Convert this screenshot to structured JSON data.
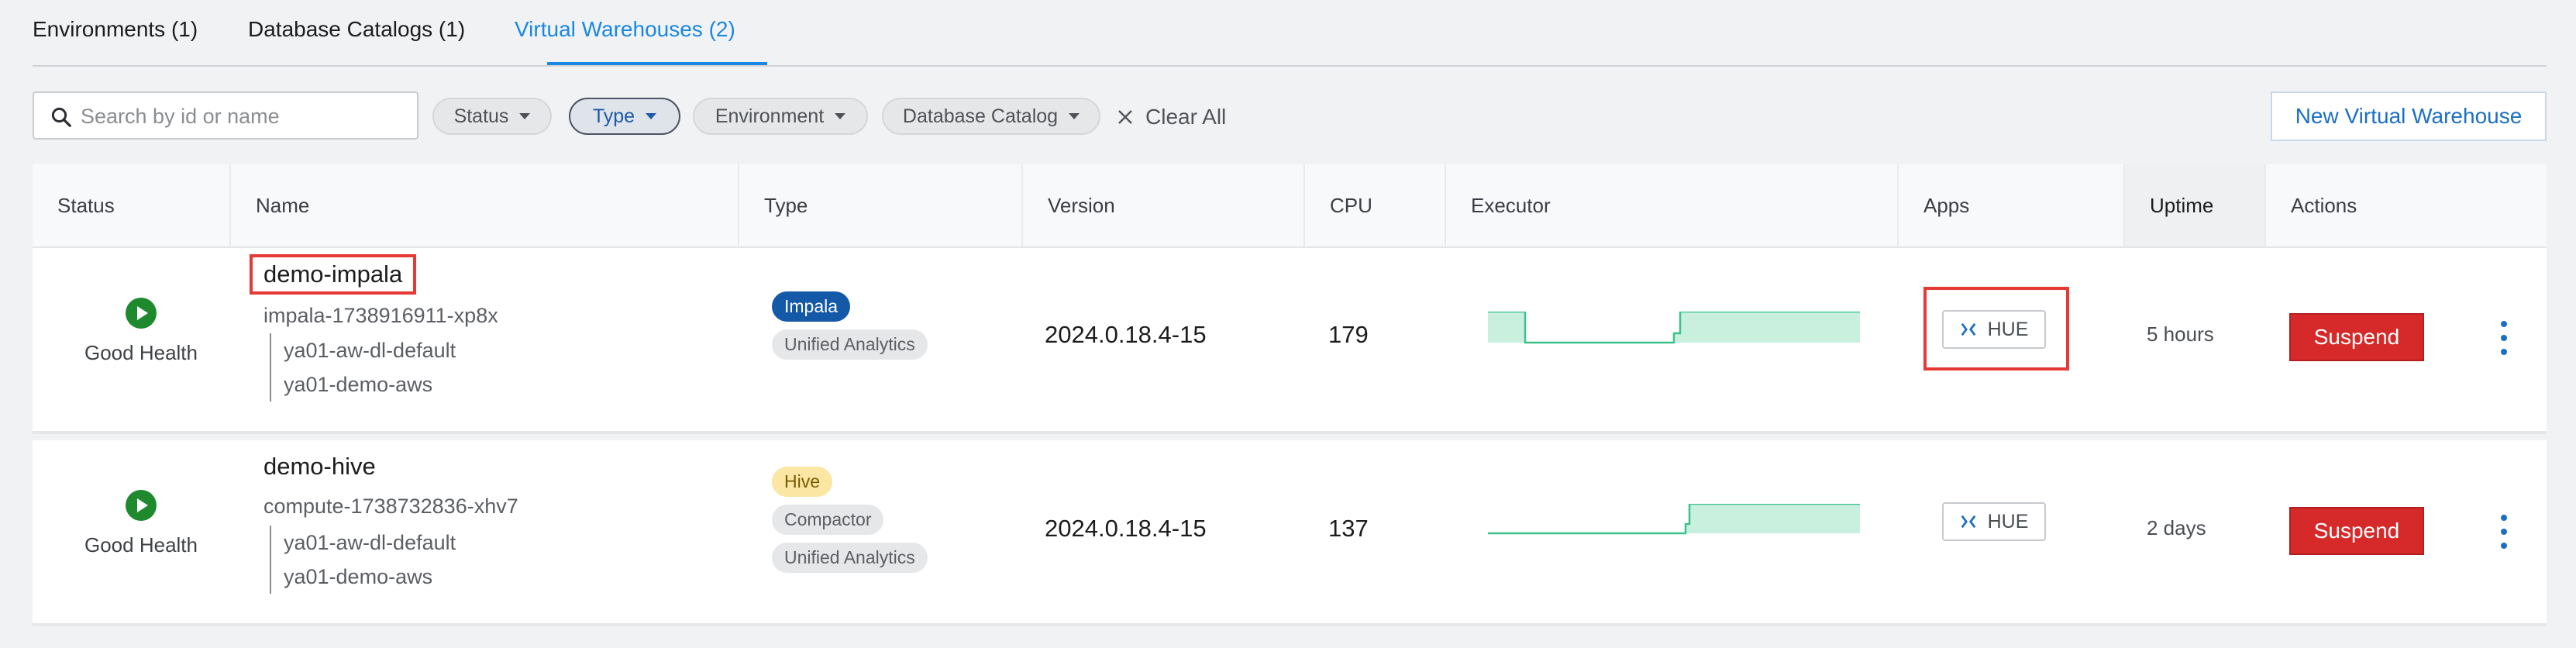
{
  "tabs": [
    {
      "label": "Environments (1)"
    },
    {
      "label": "Database Catalogs (1)"
    },
    {
      "label": "Virtual Warehouses (2)"
    }
  ],
  "search": {
    "placeholder": "Search by id or name"
  },
  "filters": [
    {
      "label": "Status"
    },
    {
      "label": "Type"
    },
    {
      "label": "Environment"
    },
    {
      "label": "Database Catalog"
    }
  ],
  "clear_all": "Clear All",
  "new_button": "New Virtual Warehouse",
  "columns": [
    "Status",
    "Name",
    "Type",
    "Version",
    "CPU",
    "Executor",
    "Apps",
    "Uptime",
    "Actions"
  ],
  "rows": [
    {
      "status": "Good Health",
      "name": "demo-impala",
      "id": "impala-1738916911-xp8x",
      "envs": [
        "ya01-aw-dl-default",
        "ya01-demo-aws"
      ],
      "types": [
        "Impala",
        "Unified Analytics"
      ],
      "version": "2024.0.18.4-15",
      "cpu": "179",
      "app": "HUE",
      "uptime": "5 hours",
      "action": "Suspend"
    },
    {
      "status": "Good Health",
      "name": "demo-hive",
      "id": "compute-1738732836-xhv7",
      "envs": [
        "ya01-aw-dl-default",
        "ya01-demo-aws"
      ],
      "types": [
        "Hive",
        "Compactor",
        "Unified Analytics"
      ],
      "version": "2024.0.18.4-15",
      "cpu": "137",
      "app": "HUE",
      "uptime": "2 days",
      "action": "Suspend"
    }
  ],
  "colors": {
    "accent": "#1a88e3",
    "healthy": "#1f8a2d",
    "suspend": "#d62a2a",
    "impala_badge": "#1458a8",
    "hive_badge": "#fbe7a3"
  }
}
